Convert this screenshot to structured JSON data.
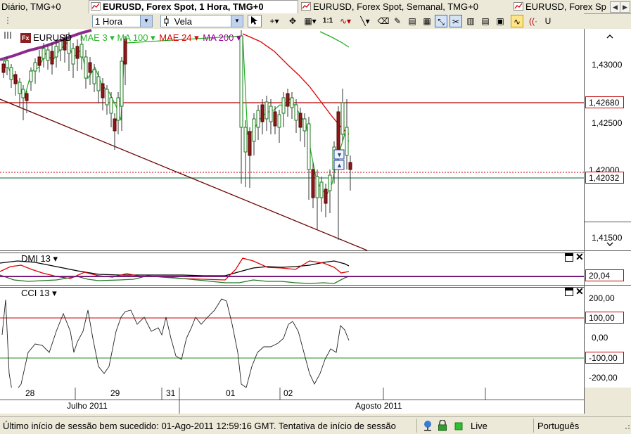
{
  "tabs": [
    {
      "label": "Diário, TMG+0",
      "active": false
    },
    {
      "label": "EURUSD, Forex Spot, 1 Hora, TMG+0",
      "active": true
    },
    {
      "label": "EURUSD, Forex Spot, Semanal, TMG+0",
      "active": false
    },
    {
      "label": "EURUSD, Forex Sp",
      "active": false
    }
  ],
  "toolbar": {
    "timeframe": "1 Hora",
    "chart_type": "Vela",
    "one_to_one": "1:1",
    "instrument_badge": "Fx",
    "instrument": "EURUSD"
  },
  "main_panel": {
    "legend": {
      "fx_badge": "Fx",
      "instrument": "EURUSD",
      "ma3": "MAE 3",
      "ma100": "MA 100",
      "mae24": "MAE 24",
      "ma200": "MA 200",
      "colors": {
        "ma3": "#2bb52b",
        "ma100": "#2bb52b",
        "mae24": "#dd0000",
        "ma200": "#990099"
      }
    },
    "price_labels": [
      "1,43000",
      "1,42500",
      "1,42000",
      "1,41500"
    ],
    "marker_high": "1,42680",
    "marker_current": "1,42032"
  },
  "dmi_panel": {
    "title": "DMI 13",
    "value_label": "20,04"
  },
  "cci_panel": {
    "title": "CCI 13",
    "labels": [
      "200,00",
      "0,00",
      "-200,00"
    ],
    "marker_upper": "100,00",
    "marker_lower": "-100,00"
  },
  "time_axis": {
    "days": [
      "28",
      "29",
      "31",
      "01",
      "02"
    ],
    "months": [
      "Julho 2011",
      "Agosto 2011"
    ]
  },
  "status": {
    "message": "Último início de sessão bem sucedido: 01-Ago-2011 12:59:16 GMT. Tentativa de início de sessão",
    "connection": "Live",
    "language": "Português"
  }
}
